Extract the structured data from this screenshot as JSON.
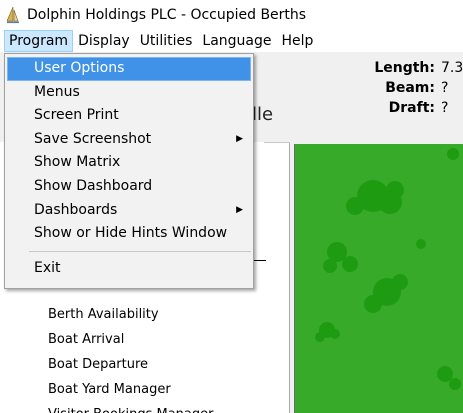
{
  "window": {
    "title": "Dolphin Holdings PLC  - Occupied Berths"
  },
  "menubar": {
    "items": [
      {
        "label": "Program"
      },
      {
        "label": "Display"
      },
      {
        "label": "Utilities"
      },
      {
        "label": "Language"
      },
      {
        "label": "Help"
      }
    ]
  },
  "dropdown": {
    "items": [
      {
        "label": "User Options",
        "highlighted": true
      },
      {
        "label": "Menus"
      },
      {
        "label": "Screen Print"
      },
      {
        "label": "Save Screenshot",
        "submenu": true
      },
      {
        "label": "Show Matrix"
      },
      {
        "label": "Show Dashboard"
      },
      {
        "label": "Dashboards",
        "submenu": true
      },
      {
        "label": "Show or Hide Hints Window"
      }
    ],
    "exit_label": "Exit",
    "highlight_color": "#3f92e8"
  },
  "boat_info": {
    "length_label": "Length:",
    "length_value": "7.3",
    "beam_label": "Beam:",
    "beam_value": "?",
    "draft_label": "Draft:",
    "draft_value": "?"
  },
  "partial_title": "lle",
  "nav": {
    "items": [
      {
        "label": "Berth Availability"
      },
      {
        "label": "Boat Arrival"
      },
      {
        "label": "Boat Departure"
      },
      {
        "label": "Boat Yard Manager"
      },
      {
        "label": "Visitor Bookings Manager"
      }
    ]
  },
  "map": {
    "background_color": "#38aa2a",
    "marker_color": "#1f9b12"
  },
  "icons": {
    "app": "sailboat-icon",
    "submenu": "chevron-right-icon",
    "panel": "star-icon"
  }
}
